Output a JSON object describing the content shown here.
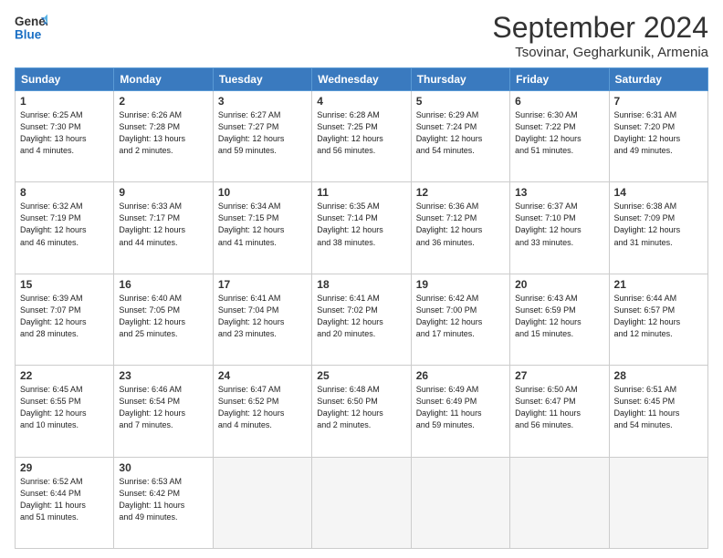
{
  "header": {
    "logo_line1": "General",
    "logo_line2": "Blue",
    "month": "September 2024",
    "location": "Tsovinar, Gegharkunik, Armenia"
  },
  "weekdays": [
    "Sunday",
    "Monday",
    "Tuesday",
    "Wednesday",
    "Thursday",
    "Friday",
    "Saturday"
  ],
  "weeks": [
    [
      {
        "day": "1",
        "info": "Sunrise: 6:25 AM\nSunset: 7:30 PM\nDaylight: 13 hours\nand 4 minutes."
      },
      {
        "day": "2",
        "info": "Sunrise: 6:26 AM\nSunset: 7:28 PM\nDaylight: 13 hours\nand 2 minutes."
      },
      {
        "day": "3",
        "info": "Sunrise: 6:27 AM\nSunset: 7:27 PM\nDaylight: 12 hours\nand 59 minutes."
      },
      {
        "day": "4",
        "info": "Sunrise: 6:28 AM\nSunset: 7:25 PM\nDaylight: 12 hours\nand 56 minutes."
      },
      {
        "day": "5",
        "info": "Sunrise: 6:29 AM\nSunset: 7:24 PM\nDaylight: 12 hours\nand 54 minutes."
      },
      {
        "day": "6",
        "info": "Sunrise: 6:30 AM\nSunset: 7:22 PM\nDaylight: 12 hours\nand 51 minutes."
      },
      {
        "day": "7",
        "info": "Sunrise: 6:31 AM\nSunset: 7:20 PM\nDaylight: 12 hours\nand 49 minutes."
      }
    ],
    [
      {
        "day": "8",
        "info": "Sunrise: 6:32 AM\nSunset: 7:19 PM\nDaylight: 12 hours\nand 46 minutes."
      },
      {
        "day": "9",
        "info": "Sunrise: 6:33 AM\nSunset: 7:17 PM\nDaylight: 12 hours\nand 44 minutes."
      },
      {
        "day": "10",
        "info": "Sunrise: 6:34 AM\nSunset: 7:15 PM\nDaylight: 12 hours\nand 41 minutes."
      },
      {
        "day": "11",
        "info": "Sunrise: 6:35 AM\nSunset: 7:14 PM\nDaylight: 12 hours\nand 38 minutes."
      },
      {
        "day": "12",
        "info": "Sunrise: 6:36 AM\nSunset: 7:12 PM\nDaylight: 12 hours\nand 36 minutes."
      },
      {
        "day": "13",
        "info": "Sunrise: 6:37 AM\nSunset: 7:10 PM\nDaylight: 12 hours\nand 33 minutes."
      },
      {
        "day": "14",
        "info": "Sunrise: 6:38 AM\nSunset: 7:09 PM\nDaylight: 12 hours\nand 31 minutes."
      }
    ],
    [
      {
        "day": "15",
        "info": "Sunrise: 6:39 AM\nSunset: 7:07 PM\nDaylight: 12 hours\nand 28 minutes."
      },
      {
        "day": "16",
        "info": "Sunrise: 6:40 AM\nSunset: 7:05 PM\nDaylight: 12 hours\nand 25 minutes."
      },
      {
        "day": "17",
        "info": "Sunrise: 6:41 AM\nSunset: 7:04 PM\nDaylight: 12 hours\nand 23 minutes."
      },
      {
        "day": "18",
        "info": "Sunrise: 6:41 AM\nSunset: 7:02 PM\nDaylight: 12 hours\nand 20 minutes."
      },
      {
        "day": "19",
        "info": "Sunrise: 6:42 AM\nSunset: 7:00 PM\nDaylight: 12 hours\nand 17 minutes."
      },
      {
        "day": "20",
        "info": "Sunrise: 6:43 AM\nSunset: 6:59 PM\nDaylight: 12 hours\nand 15 minutes."
      },
      {
        "day": "21",
        "info": "Sunrise: 6:44 AM\nSunset: 6:57 PM\nDaylight: 12 hours\nand 12 minutes."
      }
    ],
    [
      {
        "day": "22",
        "info": "Sunrise: 6:45 AM\nSunset: 6:55 PM\nDaylight: 12 hours\nand 10 minutes."
      },
      {
        "day": "23",
        "info": "Sunrise: 6:46 AM\nSunset: 6:54 PM\nDaylight: 12 hours\nand 7 minutes."
      },
      {
        "day": "24",
        "info": "Sunrise: 6:47 AM\nSunset: 6:52 PM\nDaylight: 12 hours\nand 4 minutes."
      },
      {
        "day": "25",
        "info": "Sunrise: 6:48 AM\nSunset: 6:50 PM\nDaylight: 12 hours\nand 2 minutes."
      },
      {
        "day": "26",
        "info": "Sunrise: 6:49 AM\nSunset: 6:49 PM\nDaylight: 11 hours\nand 59 minutes."
      },
      {
        "day": "27",
        "info": "Sunrise: 6:50 AM\nSunset: 6:47 PM\nDaylight: 11 hours\nand 56 minutes."
      },
      {
        "day": "28",
        "info": "Sunrise: 6:51 AM\nSunset: 6:45 PM\nDaylight: 11 hours\nand 54 minutes."
      }
    ],
    [
      {
        "day": "29",
        "info": "Sunrise: 6:52 AM\nSunset: 6:44 PM\nDaylight: 11 hours\nand 51 minutes."
      },
      {
        "day": "30",
        "info": "Sunrise: 6:53 AM\nSunset: 6:42 PM\nDaylight: 11 hours\nand 49 minutes."
      },
      null,
      null,
      null,
      null,
      null
    ]
  ]
}
